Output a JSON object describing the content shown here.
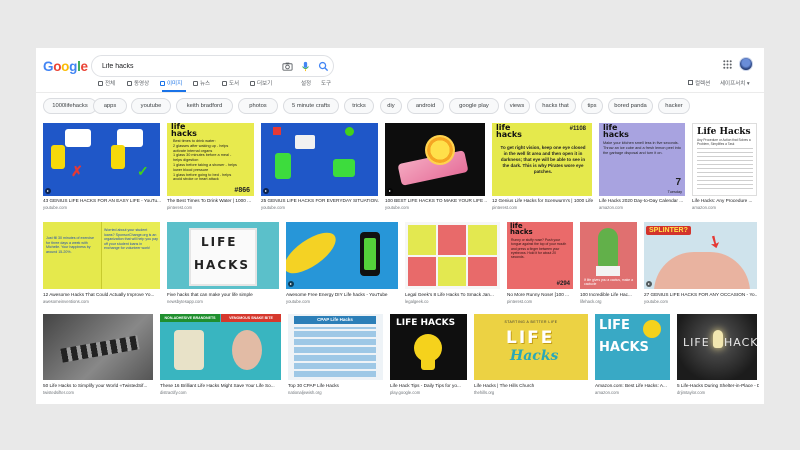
{
  "search": {
    "query": "Life hacks"
  },
  "logo": {
    "text": "Google",
    "colors": [
      "#4285F4",
      "#EA4335",
      "#FBBC05",
      "#4285F4",
      "#34A853",
      "#EA4335"
    ]
  },
  "tabs": [
    {
      "label": "전체",
      "icon": "search-icon"
    },
    {
      "label": "동영상",
      "icon": "video-icon"
    },
    {
      "label": "이미지",
      "icon": "image-icon",
      "active": true
    },
    {
      "label": "뉴스",
      "icon": "news-icon"
    },
    {
      "label": "도서",
      "icon": "book-icon"
    },
    {
      "label": "더보기",
      "icon": "more-icon"
    }
  ],
  "tools": {
    "settings": "설정",
    "tools": "도구",
    "collections": "컬렉션",
    "safesearch": "세이프서치 ▾"
  },
  "chips": [
    "1000lifehacks",
    "apps",
    "youtube",
    "keith bradford",
    "photos",
    "5 minute crafts",
    "tricks",
    "diy",
    "android",
    "google play",
    "views",
    "hacks that",
    "tips",
    "bored panda",
    "hacker"
  ],
  "results": [
    {
      "caption": "43 GENIUS LIFE HACKS FOR AN EASY LIFE - YouTu...",
      "source": "youtube.com"
    },
    {
      "caption": "The Best Times To Drink Water | 1000 ...",
      "source": "pinterest.com"
    },
    {
      "caption": "25 GENIUS LIFE HACKS FOR EVERYDAY SITUATION...",
      "source": "youtube.com"
    },
    {
      "caption": "100 BEST LIFE HACKS TO MAKE YOUR LIFE ...",
      "source": "youtube.com"
    },
    {
      "caption": "12 Genius Life Hacks for Scenwurm's | 1000 Life ...",
      "source": "pinterest.com"
    },
    {
      "caption": "Life Hacks 2020 Day-to-Day Calendar ...",
      "source": "amazon.com"
    },
    {
      "caption": "Life Hacks: Any Procedure ...",
      "source": "amazon.com"
    },
    {
      "caption": "12 Awesome Hacks That Could Actually Improve Yo...",
      "source": "awesomeinventions.com"
    },
    {
      "caption": "Five hacks that can make your life simple",
      "source": "newsbytesapp.com"
    },
    {
      "caption": "Awesome Free Energy DIY Life hacks - YouTube",
      "source": "youtube.com"
    },
    {
      "caption": "Legal Geek's 8 Life Hacks To Smack Jan...",
      "source": "legalgeek.co"
    },
    {
      "caption": "No More Runny Nose! [100 ...",
      "source": "pinterest.com"
    },
    {
      "caption": "100 Incredible Life Hac...",
      "source": "lifehack.org"
    },
    {
      "caption": "27 GENIUS LIFE HACKS FOR ANY OCCASION - Yo...",
      "source": "youtube.com"
    },
    {
      "caption": "50 Life Hacks to Simplify your World «TwistedSif...",
      "source": "twistedsifter.com"
    },
    {
      "caption": "These 16 Brilliant Life Hacks Might Save Your Life So...",
      "source": "distractify.com"
    },
    {
      "caption": "Top 30 CPAP Life Hacks",
      "source": "nationaljewish.org"
    },
    {
      "caption": "Life Hack Tips - Daily Tips for yo...",
      "source": "play.google.com"
    },
    {
      "caption": "Life Hacks | The Hills Church",
      "source": "thehills.org"
    },
    {
      "caption": "Amazon.com: Best Life Hacks: A...",
      "source": "amazon.com"
    },
    {
      "caption": "5 Life-Hacks During Shelter-in-Place - Dr. Jim Taylor",
      "source": "drjimtaylor.com"
    }
  ],
  "thumbs": {
    "life": "life",
    "hacks": "hacks",
    "lifehacks": "LIFE HACKS",
    "life_word": "LIFE",
    "hacks_word": "HACKS",
    "water": {
      "lines": [
        "Best times to drink water:",
        "2 glasses after waking up - helps",
        "activate internal organs",
        "1 glass 30 minutes before a meal -",
        "helps digestion",
        "1 glass before taking a shower - helps",
        "lower blood pressure",
        "1 glass before going to bed - helps",
        "avoid stroke or heart attack"
      ],
      "number": "#866"
    },
    "night": {
      "number": "#1108",
      "text": "To get right vision, keep one eye closed in the well lit area and then open it in darkness; that eye will be able to see in the dark. This is why Pirates wore eye patches."
    },
    "calendar": {
      "text": "Make your kitchen smell less in five seconds. Throw an ice cube and a fresh lemon peel into the garbage disposal and turn it on.",
      "day": "7",
      "weekday": "Tuesday"
    },
    "book": {
      "title": "Life Hacks",
      "subtitle": "Any Procedure or Action that Solves a Problem, Simplifies a Task"
    },
    "awesome": {
      "tl": "Just fill 30 minutes of exercise for three days a week with Michelle. Your happiness by around 15-20%.",
      "tr": "Worried about your student loans? SponsorChange.org is an organization that will help you pay off your student loans in exchange for volunteer work!"
    },
    "runny": {
      "text": "Runny or stuffy nose? Push your tongue against the top of your mouth and press a finger between your eyebrows. Hold it for about 20 seconds.",
      "number": "#294"
    },
    "cactus": {
      "text": "If life gives you a cactus,",
      "text2": "make a cactucle"
    },
    "splinter": "SPLINTER?",
    "brilliant": {
      "left": "NON-ADHESIVE BRANDNETS",
      "right": "VENOMOUS SNAKE BITE"
    },
    "cpap": "CPAP Life Hacks",
    "church": "STARTING A BETTER LIFE",
    "church_word1": "LIFE",
    "church_word2": "Hacks"
  }
}
